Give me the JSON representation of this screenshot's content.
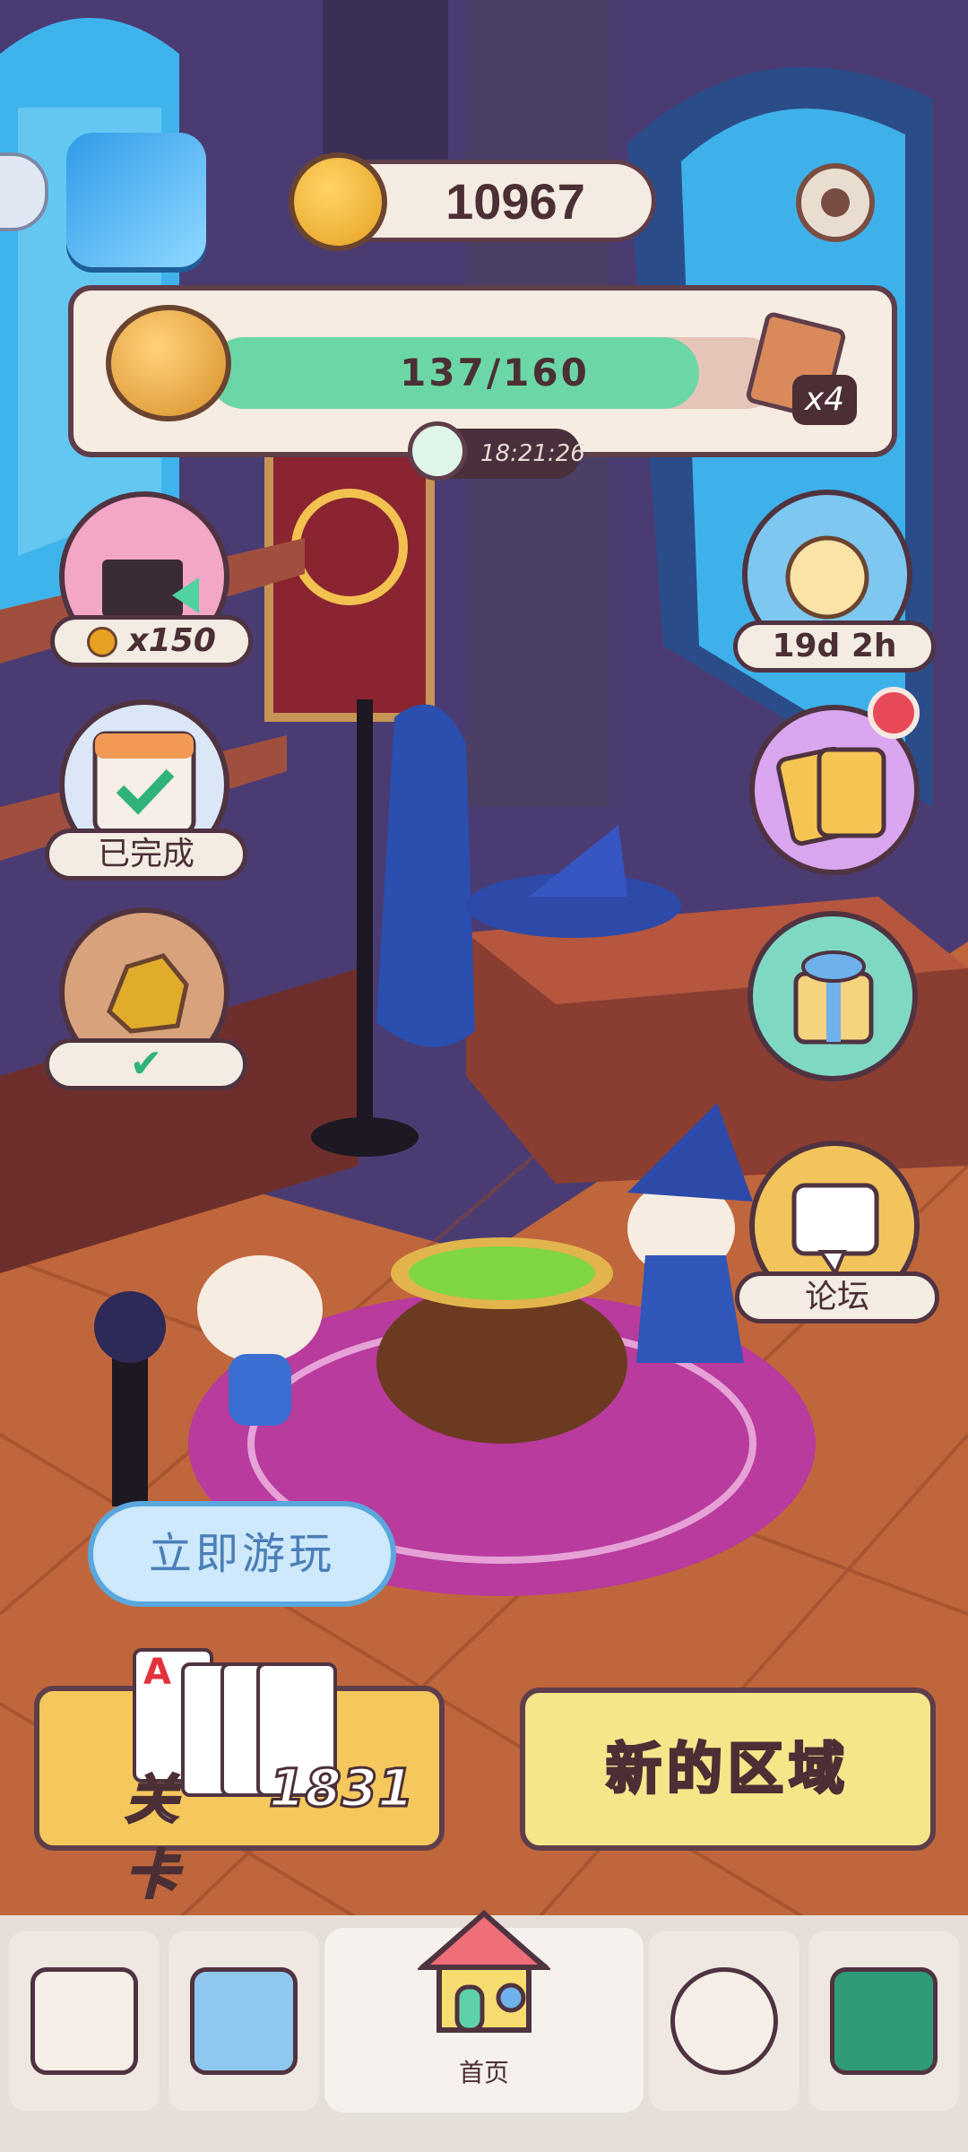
{
  "header": {
    "coins": "10967"
  },
  "progress": {
    "value_text": "137/160",
    "fraction": 0.856,
    "multiplier": "x4",
    "timer": "18:21:26"
  },
  "left_buttons": {
    "ad_reward": "x150",
    "daily_status": "已完成",
    "treasure_status": "✔"
  },
  "right_buttons": {
    "event_time": "19d 2h",
    "forum_label": "论坛"
  },
  "play": {
    "bubble_text": "立即游玩",
    "level_label": "关卡",
    "level_number": "1831",
    "new_area_label": "新的区域"
  },
  "cards": {
    "first_rank": "A"
  },
  "nav": {
    "home_label": "首页"
  },
  "colors": {
    "progress_fill": "#6cd7a6",
    "accent_dark": "#4b2f35",
    "level_card": "#f4c85d",
    "new_area": "#f6e68a"
  }
}
